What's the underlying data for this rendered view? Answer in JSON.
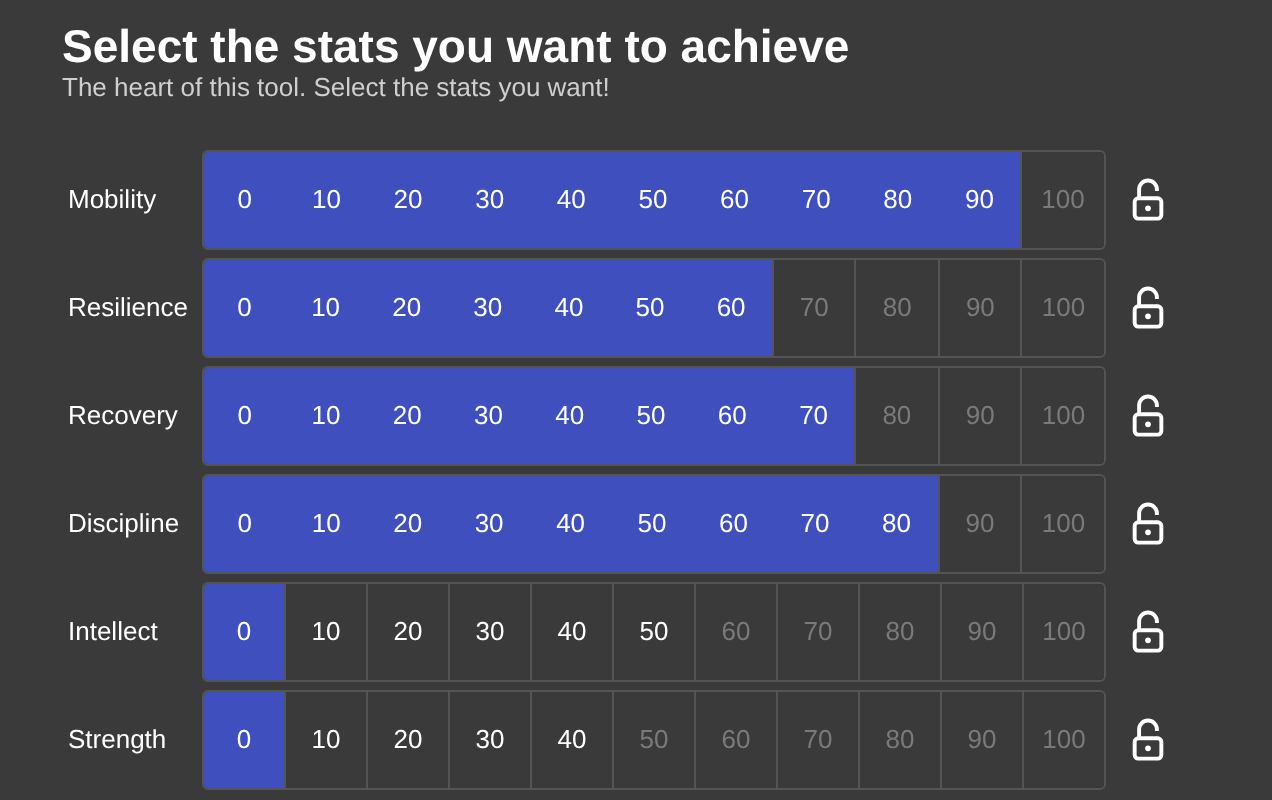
{
  "title": "Select the stats you want to achieve",
  "subtitle": "The heart of this tool. Select the stats you want!",
  "stats": [
    {
      "name": "Mobility",
      "locked": false,
      "cells": [
        {
          "label": "0",
          "selected": true,
          "available": true
        },
        {
          "label": "10",
          "selected": true,
          "available": true
        },
        {
          "label": "20",
          "selected": true,
          "available": true
        },
        {
          "label": "30",
          "selected": true,
          "available": true
        },
        {
          "label": "40",
          "selected": true,
          "available": true
        },
        {
          "label": "50",
          "selected": true,
          "available": true
        },
        {
          "label": "60",
          "selected": true,
          "available": true
        },
        {
          "label": "70",
          "selected": true,
          "available": true
        },
        {
          "label": "80",
          "selected": true,
          "available": true
        },
        {
          "label": "90",
          "selected": true,
          "available": true
        },
        {
          "label": "100",
          "selected": false,
          "available": false
        }
      ]
    },
    {
      "name": "Resilience",
      "locked": false,
      "cells": [
        {
          "label": "0",
          "selected": true,
          "available": true
        },
        {
          "label": "10",
          "selected": true,
          "available": true
        },
        {
          "label": "20",
          "selected": true,
          "available": true
        },
        {
          "label": "30",
          "selected": true,
          "available": true
        },
        {
          "label": "40",
          "selected": true,
          "available": true
        },
        {
          "label": "50",
          "selected": true,
          "available": true
        },
        {
          "label": "60",
          "selected": true,
          "available": true
        },
        {
          "label": "70",
          "selected": false,
          "available": false
        },
        {
          "label": "80",
          "selected": false,
          "available": false
        },
        {
          "label": "90",
          "selected": false,
          "available": false
        },
        {
          "label": "100",
          "selected": false,
          "available": false
        }
      ]
    },
    {
      "name": "Recovery",
      "locked": false,
      "cells": [
        {
          "label": "0",
          "selected": true,
          "available": true
        },
        {
          "label": "10",
          "selected": true,
          "available": true
        },
        {
          "label": "20",
          "selected": true,
          "available": true
        },
        {
          "label": "30",
          "selected": true,
          "available": true
        },
        {
          "label": "40",
          "selected": true,
          "available": true
        },
        {
          "label": "50",
          "selected": true,
          "available": true
        },
        {
          "label": "60",
          "selected": true,
          "available": true
        },
        {
          "label": "70",
          "selected": true,
          "available": true
        },
        {
          "label": "80",
          "selected": false,
          "available": false
        },
        {
          "label": "90",
          "selected": false,
          "available": false
        },
        {
          "label": "100",
          "selected": false,
          "available": false
        }
      ]
    },
    {
      "name": "Discipline",
      "locked": false,
      "cells": [
        {
          "label": "0",
          "selected": true,
          "available": true
        },
        {
          "label": "10",
          "selected": true,
          "available": true
        },
        {
          "label": "20",
          "selected": true,
          "available": true
        },
        {
          "label": "30",
          "selected": true,
          "available": true
        },
        {
          "label": "40",
          "selected": true,
          "available": true
        },
        {
          "label": "50",
          "selected": true,
          "available": true
        },
        {
          "label": "60",
          "selected": true,
          "available": true
        },
        {
          "label": "70",
          "selected": true,
          "available": true
        },
        {
          "label": "80",
          "selected": true,
          "available": true
        },
        {
          "label": "90",
          "selected": false,
          "available": false
        },
        {
          "label": "100",
          "selected": false,
          "available": false
        }
      ]
    },
    {
      "name": "Intellect",
      "locked": false,
      "cells": [
        {
          "label": "0",
          "selected": true,
          "available": true
        },
        {
          "label": "10",
          "selected": false,
          "available": true
        },
        {
          "label": "20",
          "selected": false,
          "available": true
        },
        {
          "label": "30",
          "selected": false,
          "available": true
        },
        {
          "label": "40",
          "selected": false,
          "available": true
        },
        {
          "label": "50",
          "selected": false,
          "available": true
        },
        {
          "label": "60",
          "selected": false,
          "available": false
        },
        {
          "label": "70",
          "selected": false,
          "available": false
        },
        {
          "label": "80",
          "selected": false,
          "available": false
        },
        {
          "label": "90",
          "selected": false,
          "available": false
        },
        {
          "label": "100",
          "selected": false,
          "available": false
        }
      ]
    },
    {
      "name": "Strength",
      "locked": false,
      "cells": [
        {
          "label": "0",
          "selected": true,
          "available": true
        },
        {
          "label": "10",
          "selected": false,
          "available": true
        },
        {
          "label": "20",
          "selected": false,
          "available": true
        },
        {
          "label": "30",
          "selected": false,
          "available": true
        },
        {
          "label": "40",
          "selected": false,
          "available": true
        },
        {
          "label": "50",
          "selected": false,
          "available": false
        },
        {
          "label": "60",
          "selected": false,
          "available": false
        },
        {
          "label": "70",
          "selected": false,
          "available": false
        },
        {
          "label": "80",
          "selected": false,
          "available": false
        },
        {
          "label": "90",
          "selected": false,
          "available": false
        },
        {
          "label": "100",
          "selected": false,
          "available": false
        }
      ]
    }
  ]
}
